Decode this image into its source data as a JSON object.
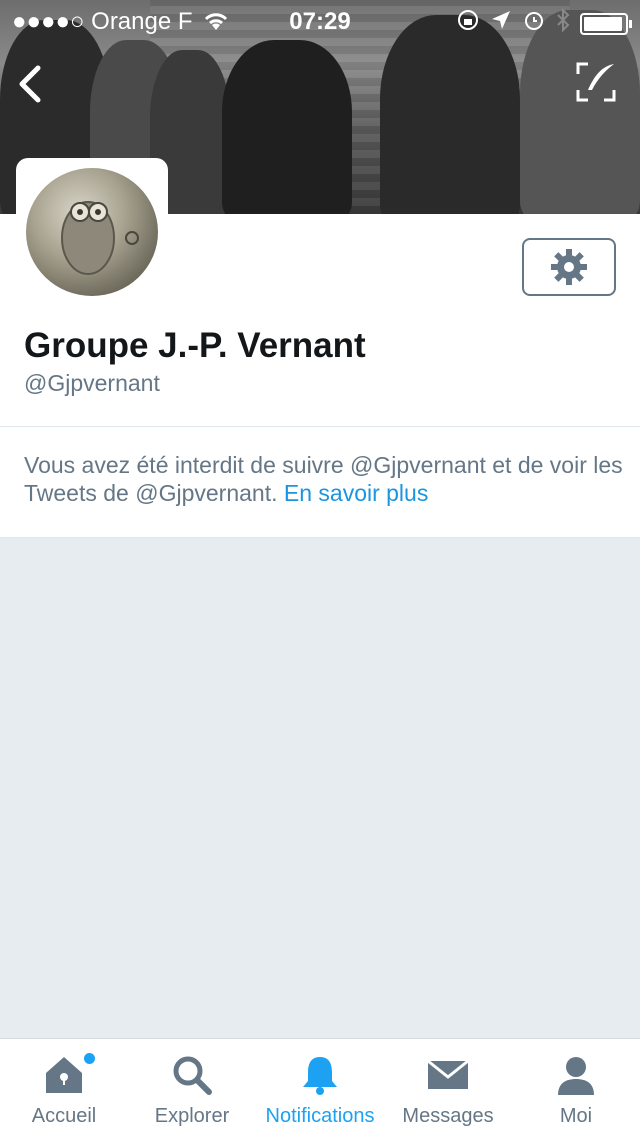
{
  "status_bar": {
    "carrier": "●●●●○ Orange F",
    "time": "07:29"
  },
  "profile": {
    "display_name": "Groupe J.-P. Vernant",
    "handle": "@Gjpvernant"
  },
  "blocked_notice": {
    "text": "Vous avez été interdit de suivre @Gjpvernant et de voir les Tweets de @Gjpvernant.",
    "link_label": "En savoir plus"
  },
  "tabbar": {
    "items": [
      {
        "label": "Accueil",
        "icon": "home-icon"
      },
      {
        "label": "Explorer",
        "icon": "search-icon"
      },
      {
        "label": "Notifications",
        "icon": "bell-icon"
      },
      {
        "label": "Messages",
        "icon": "envelope-icon"
      },
      {
        "label": "Moi",
        "icon": "person-icon"
      }
    ],
    "active_index": 2
  },
  "colors": {
    "accent": "#1da1f2",
    "muted": "#657786",
    "background": "#e6ecf0"
  }
}
